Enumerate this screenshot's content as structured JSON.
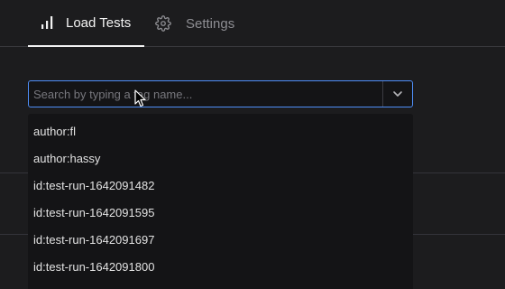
{
  "tabs": [
    {
      "label": "Load Tests",
      "icon": "bar-chart-icon",
      "active": true
    },
    {
      "label": "Settings",
      "icon": "gear-icon",
      "active": false
    }
  ],
  "search": {
    "placeholder": "Search by typing a tag name...",
    "value": ""
  },
  "dropdown": {
    "options": [
      "author:fl",
      "author:hassy",
      "id:test-run-1642091482",
      "id:test-run-1642091595",
      "id:test-run-1642091697",
      "id:test-run-1642091800"
    ]
  },
  "colors": {
    "background": "#1c1c1e",
    "focus_border": "#4e8ef7",
    "active_tab_underline": "#f2f2f2",
    "muted_text": "#8d8d92"
  }
}
